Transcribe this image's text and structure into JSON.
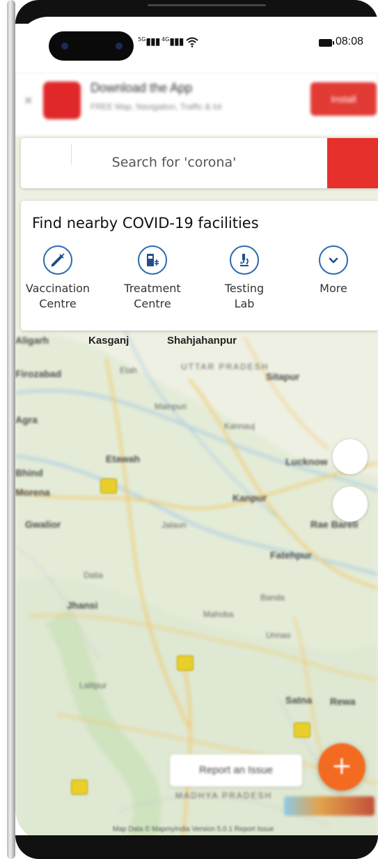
{
  "status_bar": {
    "signal_1": "5G",
    "signal_2": "4G",
    "time": "08:08"
  },
  "app_banner": {
    "title": "Download the App",
    "subtitle": "FREE Map, Navigation, Traffic & lot",
    "install_label": "Install"
  },
  "search": {
    "placeholder": "Search for 'corona'"
  },
  "covid_panel": {
    "title": "Find nearby COVID-19 facilities",
    "facilities": [
      {
        "label_1": "Vaccination",
        "label_2": "Centre",
        "icon": "syringe-icon"
      },
      {
        "label_1": "Treatment",
        "label_2": "Centre",
        "icon": "hospital-icon"
      },
      {
        "label_1": "Testing",
        "label_2": "Lab",
        "icon": "microscope-icon"
      },
      {
        "label_1": "More",
        "label_2": "",
        "icon": "chevron-down-icon"
      }
    ]
  },
  "map": {
    "labels": [
      "Kasganj",
      "Shahjahanpur",
      "Etah",
      "UTTAR PRADESH",
      "Sitapur",
      "Agra",
      "Mainpuri",
      "Kannauj",
      "Etawah",
      "Lucknow",
      "Kanpur",
      "Jalaun",
      "Gwalior",
      "Fatehpur",
      "Jhansi",
      "Datia",
      "Banda",
      "Mahoba",
      "Lalitpur",
      "Satna",
      "Rewa",
      "Aligarh",
      "Firozabad",
      "Morena",
      "Bhind",
      "Unnao",
      "Rae Bareli",
      "MADHYA PRADESH"
    ],
    "report_issue_label": "Report an Issue",
    "fab_icon": "+",
    "attribution": "Map Data © MapmyIndia  Version 5.0.1  Report Issue"
  },
  "colors": {
    "brand_red": "#e5302b",
    "accent_blue": "#2b6cb0",
    "fab_orange": "#f36a21"
  }
}
